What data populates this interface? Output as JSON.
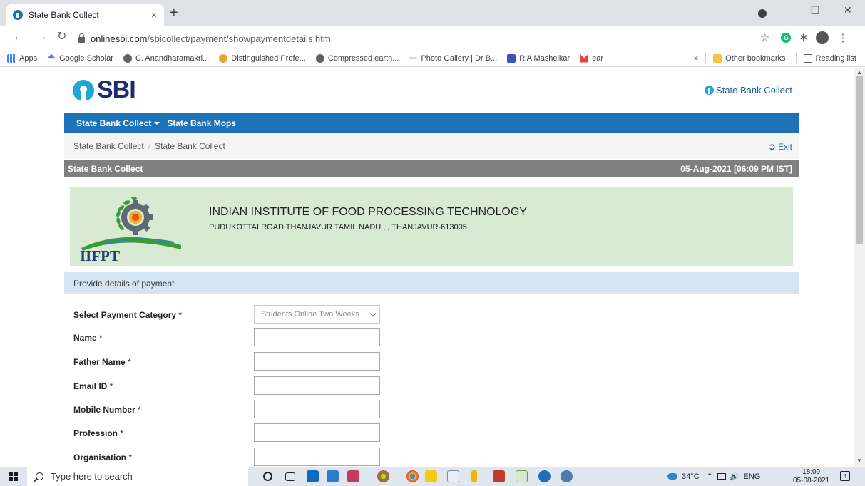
{
  "browser": {
    "tab_title": "State Bank Collect",
    "tab_close": "×",
    "new_tab": "+",
    "url_host": "onlinesbi.com",
    "url_path": "/sbicollect/payment/showpaymentdetails.htm",
    "bookmarks": [
      {
        "label": "Apps",
        "color": "#4285f4"
      },
      {
        "label": "Google Scholar",
        "color": "#4285f4"
      },
      {
        "label": "C. Anandharamakri...",
        "color": "#5f6368"
      },
      {
        "label": "Distinguished Profe...",
        "color": "#e8a33d"
      },
      {
        "label": "Compressed earth...",
        "color": "#5f6368"
      },
      {
        "label": "Photo Gallery | Dr B...",
        "color": "#c9b98f"
      },
      {
        "label": "R A Mashelkar",
        "color": "#3f51b5"
      },
      {
        "label": "ear",
        "color": "#ea4335"
      }
    ],
    "overflow": "»",
    "other_bookmarks": "Other bookmarks",
    "reading_list": "Reading list"
  },
  "header": {
    "logo_text": "SBI",
    "collect_logo_text": "State Bank Collect"
  },
  "nav": {
    "items": [
      "State Bank Collect",
      "State Bank Mops"
    ]
  },
  "breadcrumb": {
    "items": [
      "State Bank Collect",
      "State Bank Collect"
    ],
    "exit_label": "Exit"
  },
  "panel": {
    "title": "State Bank Collect",
    "datetime": "05-Aug-2021 [06:09 PM IST]"
  },
  "institute": {
    "logo_text": "IIFPT",
    "name": "INDIAN INSTITUTE OF FOOD PROCESSING TECHNOLOGY",
    "address": "PUDUKOTTAI ROAD THANJAVUR TAMIL NADU , , THANJAVUR-613005"
  },
  "form": {
    "section_title": "Provide details of payment",
    "category_label": "Select Payment Category",
    "category_value": "Students Online Two Weeks",
    "fields": [
      {
        "label": "Name"
      },
      {
        "label": "Father Name"
      },
      {
        "label": "Email ID"
      },
      {
        "label": "Mobile Number"
      },
      {
        "label": "Profession"
      },
      {
        "label": "Organisation"
      }
    ],
    "required_marker": "*"
  },
  "taskbar": {
    "search_placeholder": "Type here to search",
    "weather": "34°C",
    "language": "ENG",
    "time": "18:09",
    "date": "05-08-2021",
    "notifications": "4"
  }
}
